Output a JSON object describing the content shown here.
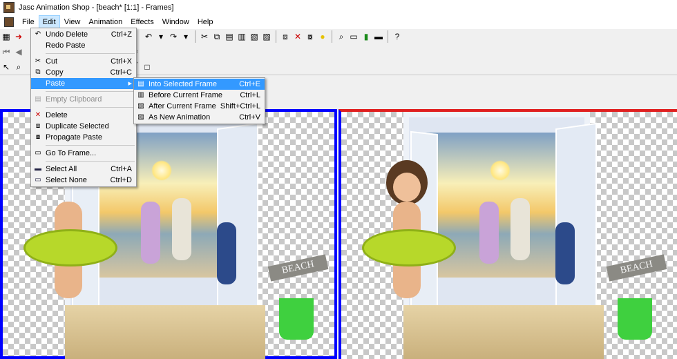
{
  "window": {
    "title": "Jasc Animation Shop - [beach* [1:1] - Frames]"
  },
  "menubar": [
    "File",
    "Edit",
    "View",
    "Animation",
    "Effects",
    "Window",
    "Help"
  ],
  "edit_menu": {
    "items": [
      {
        "label": "Undo Delete",
        "shortcut": "Ctrl+Z",
        "icon": "undo-icon"
      },
      {
        "label": "Redo Paste",
        "shortcut": "",
        "icon": "redo-icon"
      },
      {
        "label": "Cut",
        "shortcut": "Ctrl+X",
        "icon": "scissors-icon"
      },
      {
        "label": "Copy",
        "shortcut": "Ctrl+C",
        "icon": "copy-icon"
      },
      {
        "label": "Paste",
        "shortcut": "",
        "icon": ""
      },
      {
        "label": "Empty Clipboard",
        "shortcut": "",
        "icon": "clipboard-icon"
      },
      {
        "label": "Delete",
        "shortcut": "",
        "icon": "delete-icon"
      },
      {
        "label": "Duplicate Selected",
        "shortcut": "",
        "icon": "duplicate-icon"
      },
      {
        "label": "Propagate Paste",
        "shortcut": "",
        "icon": "propagate-icon"
      },
      {
        "label": "Go To Frame...",
        "shortcut": "",
        "icon": "goto-icon"
      },
      {
        "label": "Select All",
        "shortcut": "Ctrl+A",
        "icon": "select-all-icon"
      },
      {
        "label": "Select None",
        "shortcut": "Ctrl+D",
        "icon": "select-none-icon"
      }
    ]
  },
  "paste_submenu": {
    "items": [
      {
        "label": "Into Selected Frame",
        "shortcut": "Ctrl+E"
      },
      {
        "label": "Before Current Frame",
        "shortcut": "Ctrl+L"
      },
      {
        "label": "After Current Frame",
        "shortcut": "Shift+Ctrl+L"
      },
      {
        "label": "As New Animation",
        "shortcut": "Ctrl+V"
      }
    ]
  },
  "scene": {
    "sign_text": "BEACH"
  },
  "colors": {
    "frame_border": "#0000ff",
    "selected_frame_marker": "#e02020",
    "highlight": "#3399ff"
  }
}
